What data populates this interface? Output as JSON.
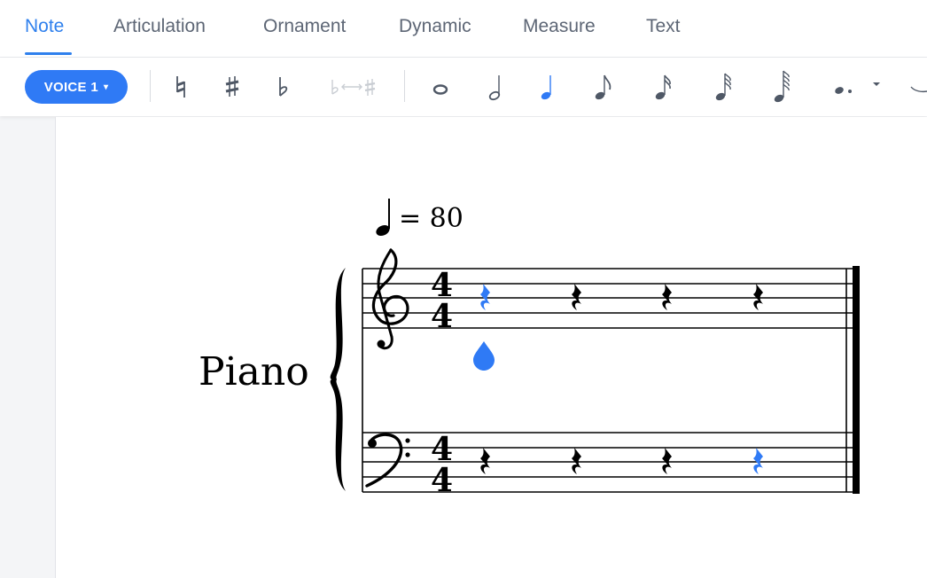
{
  "tabs": [
    {
      "label": "Note",
      "active": true
    },
    {
      "label": "Articulation",
      "active": false
    },
    {
      "label": "Ornament",
      "active": false
    },
    {
      "label": "Dynamic",
      "active": false
    },
    {
      "label": "Measure",
      "active": false
    },
    {
      "label": "Text",
      "active": false
    }
  ],
  "toolbar": {
    "voice_label": "VOICE 1",
    "accidentals": [
      "natural-icon",
      "sharp-icon",
      "flat-icon",
      "enharmonic-icon"
    ],
    "durations": [
      "whole-note-icon",
      "half-note-icon",
      "quarter-note-icon",
      "eighth-note-icon",
      "sixteenth-note-icon",
      "thirty-second-note-icon",
      "sixty-fourth-note-icon",
      "dot-icon"
    ],
    "selected_duration": "quarter-note-icon"
  },
  "score": {
    "instrument": "Piano",
    "tempo_text": "= 80",
    "time_signature": {
      "numerator": "4",
      "denominator": "4"
    },
    "treble_rests": 4,
    "bass_rests": 4
  },
  "colors": {
    "accent": "#2f7af5",
    "tab_active": "#2f80ed",
    "tab_inactive": "#5d6675",
    "icon": "#4f5866",
    "icon_disabled": "#c9cdd3"
  }
}
